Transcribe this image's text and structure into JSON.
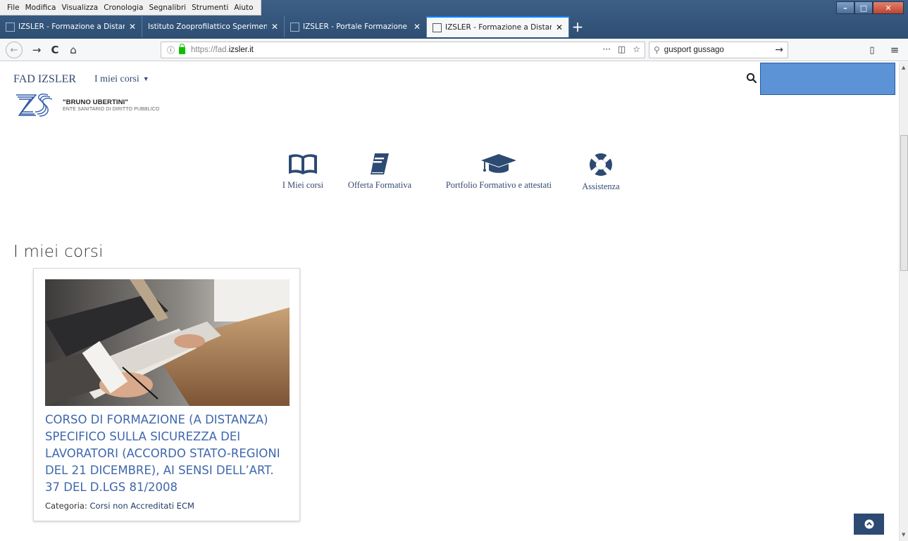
{
  "browser": {
    "menu": [
      "File",
      "Modifica",
      "Visualizza",
      "Cronologia",
      "Segnalibri",
      "Strumenti",
      "Aiuto"
    ],
    "tabs": [
      {
        "label": "IZSLER - Formazione a Distanza",
        "close": "✕"
      },
      {
        "label": "Istituto Zooprofilattico Sperimental",
        "close": "✕"
      },
      {
        "label": "IZSLER - Portale Formazione - (",
        "close": "✕"
      },
      {
        "label": "IZSLER - Formazione a Distanza",
        "close": "✕"
      }
    ],
    "new_tab": "+",
    "back": "←",
    "forward": "→",
    "reload": "C",
    "home": "⌂",
    "url_info": "ⓘ",
    "url_prefix": "https://fad.",
    "url_domain": "izsler.it",
    "page_actions": "···",
    "pocket": "◫",
    "bookmark": "☆",
    "search_icon": "⚲",
    "search_value": "gusport gussago",
    "search_go": "→",
    "sidebar_toggle": "▯",
    "app_menu": "≡",
    "win_min": "–",
    "win_max": "□",
    "win_close": "✕"
  },
  "site": {
    "brand": "FAD IZSLER",
    "my_courses_menu": "I miei corsi",
    "caret": "▼",
    "logo_name": "\"BRUNO UBERTINI\"",
    "logo_sub": "ENTE SANITARIO DI DIRITTO PUBBLICO"
  },
  "quicklinks": [
    {
      "label": "I Miei corsi",
      "icon": "book-open-icon"
    },
    {
      "label": "Offerta Formativa",
      "icon": "book-icon"
    },
    {
      "label": "Portfolio Formativo e attestati",
      "icon": "graduation-cap-icon"
    },
    {
      "label": "Assistenza",
      "icon": "life-ring-icon"
    }
  ],
  "main": {
    "section_title": "I miei corsi",
    "courses": [
      {
        "title": "CORSO DI FORMAZIONE (A DISTANZA) SPECIFICO SULLA SICUREZZA DEI LAVORATORI (ACCORDO STATO-REGIONI DEL 21 DICEMBRE), AI SENSI DELL’ART. 37 DEL D.LGS 81/2008",
        "category_label": "Categoria:",
        "category": "Corsi non Accreditati ECM"
      }
    ]
  },
  "colors": {
    "accent": "#334a73",
    "link": "#3f67ad",
    "to_top": "#2c4a72",
    "highlight_box": "#5b93d6"
  }
}
